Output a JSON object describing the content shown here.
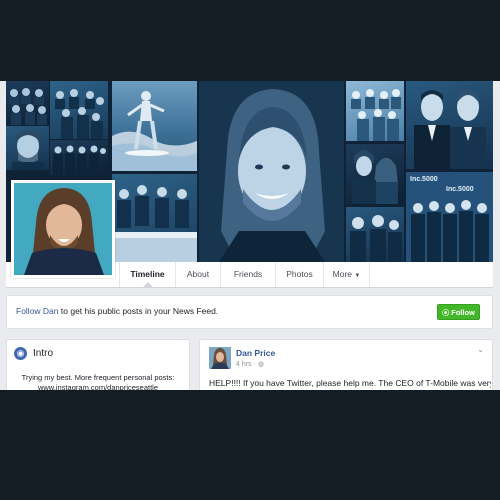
{
  "profile": {
    "name": "Dan Price"
  },
  "tabs": [
    {
      "label": "Timeline"
    },
    {
      "label": "About"
    },
    {
      "label": "Friends"
    },
    {
      "label": "Photos"
    },
    {
      "label": "More"
    }
  ],
  "cover_labels": {
    "inc_top": "Inc.5000",
    "inc_bottom": "Inc.5000"
  },
  "follow_banner": {
    "link_text": "Follow Dan",
    "text": " to get his public posts in your News Feed.",
    "button_label": "Follow"
  },
  "intro": {
    "title": "Intro",
    "bio": "Trying my best. More frequent personal posts: www.instagram.com/danpriceseattle"
  },
  "post": {
    "author": "Dan Price",
    "time": "4 hrs",
    "separator": "·",
    "text": "HELP!!!! If you have Twitter, please help me. The CEO of T-Mobile was very"
  },
  "icons": {
    "intro": "globe-icon",
    "follow": "rss-icon",
    "more": "caret-down-icon",
    "post_menu": "chevron-down-icon",
    "privacy": "globe-icon"
  },
  "colors": {
    "page_bg": "#e9ebee",
    "outer_bg": "#141c24",
    "link": "#365899",
    "follow_button": "#42b72a",
    "cover_tint": "#1d3d5c"
  }
}
